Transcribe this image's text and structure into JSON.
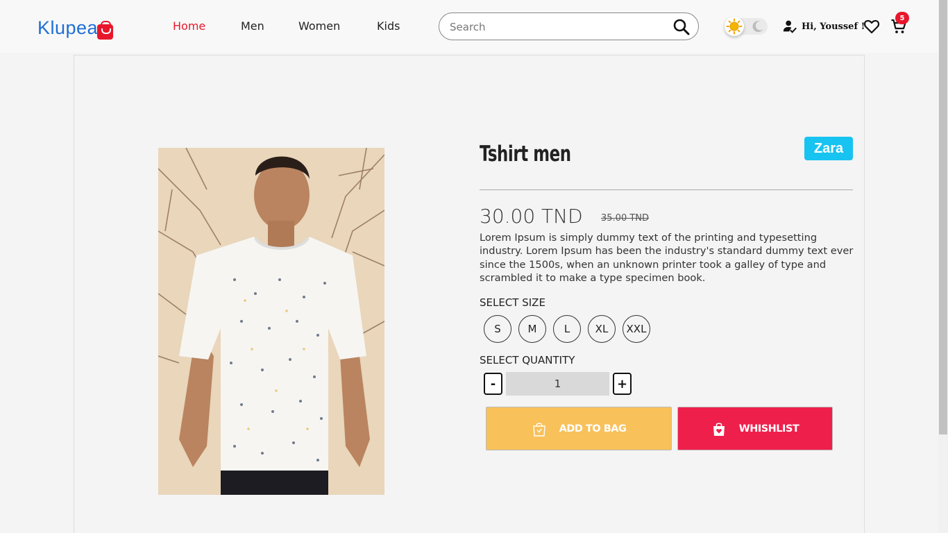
{
  "brand": {
    "logo_text": "Klupea",
    "logo_color": "#1f6fd6",
    "accent": "#e8172c"
  },
  "nav": {
    "items": [
      {
        "label": "Home",
        "active": true
      },
      {
        "label": "Men",
        "active": false
      },
      {
        "label": "Women",
        "active": false
      },
      {
        "label": "Kids",
        "active": false
      }
    ]
  },
  "search": {
    "placeholder": "Search",
    "value": "",
    "icon": "search-icon"
  },
  "theme_toggle": {
    "mode": "light",
    "icons": [
      "sun-icon",
      "moon-icon"
    ]
  },
  "user": {
    "greeting": "Hi, Youssef !",
    "icon": "user-check-icon"
  },
  "wishlist": {
    "icon": "heart-icon"
  },
  "cart": {
    "icon": "cart-icon",
    "count": "5"
  },
  "product": {
    "title": "Tshirt men",
    "brand": "Zara",
    "brand_color": "#17c3f0",
    "price": "30.00 TND",
    "old_price": "35.00 TND",
    "description": "Lorem Ipsum is simply dummy text of the printing and typesetting industry. Lorem Ipsum has been the industry's standard dummy text ever since the 1500s, when an unknown printer took a galley of type and scrambled it to make a type specimen book.",
    "size_label": "SELECT SIZE",
    "sizes": [
      "S",
      "M",
      "L",
      "XL",
      "XXL"
    ],
    "quantity_label": "SELECT QUANTITY",
    "quantity": "1",
    "minus_label": "-",
    "plus_label": "+",
    "add_to_bag_label": "ADD TO BAG",
    "wishlist_label": "WHISHLIST",
    "add_color": "#f8c15a",
    "wishlist_color": "#ef1f4b"
  }
}
